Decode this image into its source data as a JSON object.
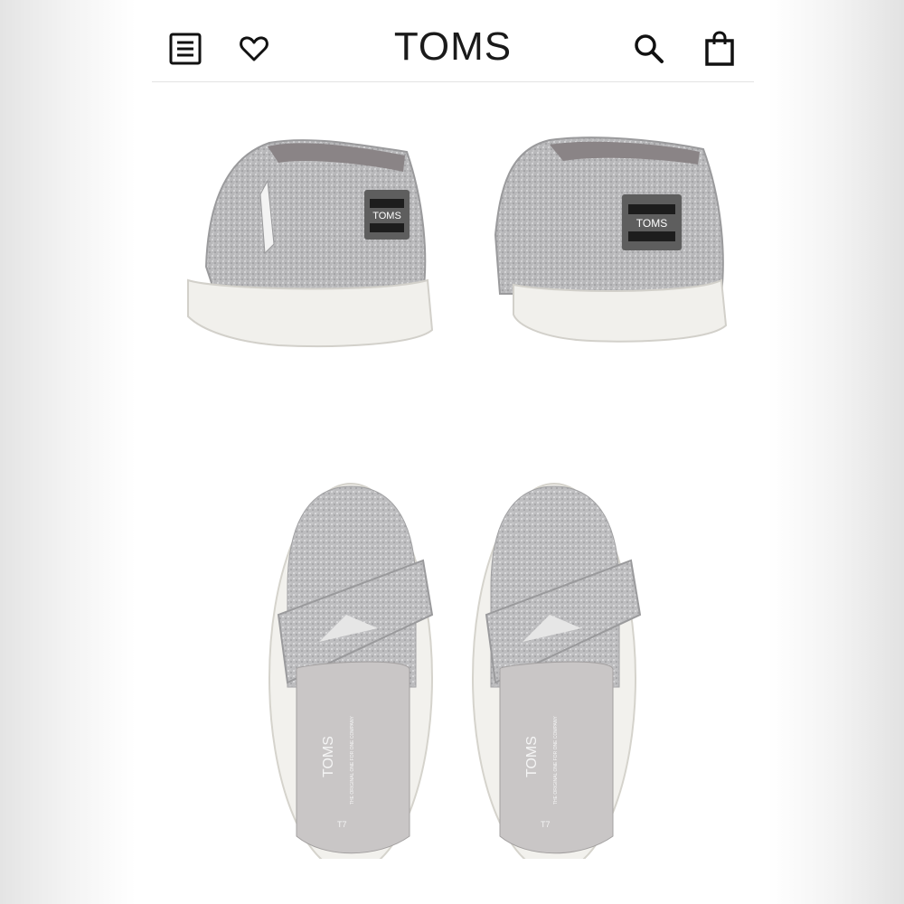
{
  "header": {
    "brand": "TOMS",
    "icons": [
      "menu-icon",
      "heart-icon",
      "search-icon",
      "shopping-bag-icon"
    ]
  },
  "gallery": {
    "back_view": {
      "heel_label": "TOMS",
      "heel_tab_text": "TOMS"
    },
    "top_view": {
      "insole_brand": "TOMS",
      "insole_tagline": "THE ORIGINAL ONE FOR ONE COMPANY",
      "size_mark": "T7"
    }
  },
  "colors": {
    "glitter": "#b9b9bb",
    "sole": "#f1f0ec",
    "insole": "#c9c6c6",
    "patch": "#5e5e5e"
  }
}
